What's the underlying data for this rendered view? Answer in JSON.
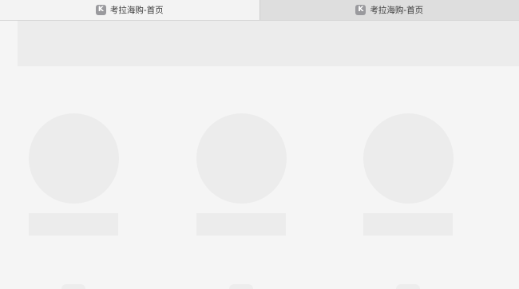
{
  "tabs": [
    {
      "favicon_letter": "K",
      "title": "考拉海购-首页",
      "state": "active"
    },
    {
      "favicon_letter": "K",
      "title": "考拉海购-首页",
      "state": "inactive"
    }
  ],
  "placeholder_color": "#ececec",
  "page_background": "#f5f5f5"
}
